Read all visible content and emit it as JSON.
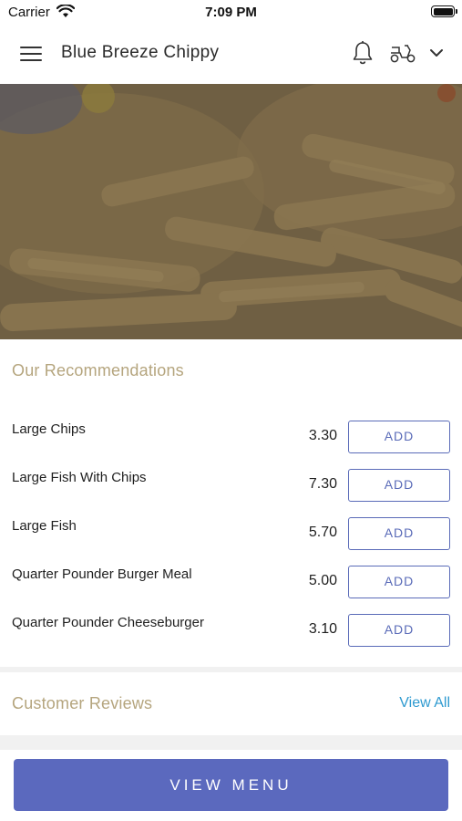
{
  "status_bar": {
    "carrier": "Carrier",
    "time": "7:09 PM"
  },
  "header": {
    "title": "Blue Breeze Chippy",
    "icons": [
      "menu-icon",
      "bell-icon",
      "scooter-icon",
      "chevron-down-icon"
    ]
  },
  "hero": {
    "image": "fish-and-chips-photo"
  },
  "recommendations": {
    "title": "Our Recommendations",
    "items": [
      {
        "name": "Large Chips",
        "price": "3.30",
        "button": "ADD"
      },
      {
        "name": "Large Fish With Chips",
        "price": "7.30",
        "button": "ADD"
      },
      {
        "name": "Large Fish",
        "price": "5.70",
        "button": "ADD"
      },
      {
        "name": "Quarter Pounder Burger Meal",
        "price": "5.00",
        "button": "ADD"
      },
      {
        "name": "Quarter Pounder Cheeseburger",
        "price": "3.10",
        "button": "ADD"
      }
    ]
  },
  "reviews": {
    "title": "Customer Reviews",
    "view_all": "View All"
  },
  "footer": {
    "view_menu": "VIEW MENU"
  },
  "colors": {
    "accent": "#5b69be",
    "section_title": "#b5a57e",
    "link": "#2e9ad0"
  }
}
